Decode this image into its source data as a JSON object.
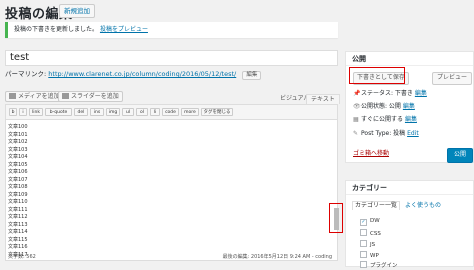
{
  "header": {
    "title": "投稿の編集",
    "add_new": "新規追加"
  },
  "notice": {
    "text": "投稿の下書きを更新しました。",
    "link": "投稿をプレビュー"
  },
  "post": {
    "title": "test"
  },
  "permalink": {
    "label": "パーマリンク:",
    "url": "http://www.clarenet.co.jp/column/coding/2016/05/12/test/",
    "edit": "編集"
  },
  "media": {
    "add_media": "メディアを追加",
    "add_slider": "スライダーを追加"
  },
  "editor_tabs": {
    "visual": "ビジュアル",
    "text": "テキスト"
  },
  "quicktags": [
    "b",
    "i",
    "link",
    "b-quote",
    "del",
    "ins",
    "img",
    "ul",
    "ol",
    "li",
    "code",
    "more",
    "タグを閉じる"
  ],
  "content_lines": [
    "文章100",
    "文章101",
    "文章102",
    "文章103",
    "文章104",
    "文章105",
    "文章106",
    "文章107",
    "文章108",
    "文章109",
    "文章110",
    "文章111",
    "文章112",
    "文章113",
    "文章114",
    "文章115",
    "文章116",
    "文章117"
  ],
  "status_bar": {
    "word_count": "文字数: 562",
    "last_edit": "最後の編集: 2016年5月12日 9:24 AM - coding"
  },
  "publish_box": {
    "title": "公開",
    "save_draft": "下書きとして保存",
    "preview": "プレビュー",
    "status_label": "ステータス: 下書き",
    "status_edit": "編集",
    "visibility_label": "公開状態: 公開",
    "visibility_edit": "編集",
    "schedule_label": "すぐに公開する",
    "schedule_edit": "編集",
    "post_type_label": "Post Type: 投稿",
    "post_type_edit": "Edit",
    "trash": "ゴミ箱へ移動",
    "publish": "公開"
  },
  "categories_box": {
    "title": "カテゴリー",
    "tab_all": "カテゴリー一覧",
    "tab_popular": "よく使うもの",
    "items": [
      {
        "label": "DW",
        "checked": true
      },
      {
        "label": "CSS",
        "checked": false
      },
      {
        "label": "JS",
        "checked": false
      },
      {
        "label": "WP",
        "checked": false
      },
      {
        "label": "プラグイン",
        "checked": false
      }
    ]
  },
  "colors": {
    "accent": "#0073aa",
    "publish": "#0085ba",
    "highlight": "#dd0000",
    "notice_border": "#46b450"
  }
}
